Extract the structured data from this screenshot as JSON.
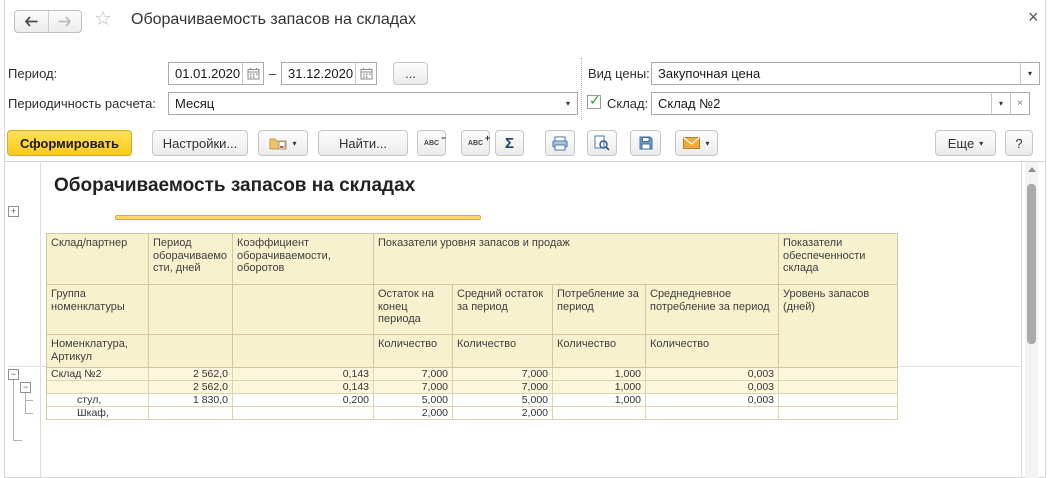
{
  "window": {
    "title": "Оборачиваемость запасов на складах"
  },
  "glyphs": {
    "dropdown": "▾",
    "close": "×",
    "star": "☆",
    "dash": "–",
    "ellipsis": "...",
    "plus": "+",
    "minus": "−",
    "sigma": "Σ",
    "abc": "ABC",
    "sup_minus": "−",
    "sup_plus": "+",
    "clear": "×",
    "check": "✓"
  },
  "filters": {
    "period_label": "Период:",
    "period_from": "01.01.2020",
    "period_to": "31.12.2020",
    "periodicity_label": "Периодичность расчета:",
    "periodicity_value": "Месяц",
    "price_type_label": "Вид цены:",
    "price_type_value": "Закупочная цена",
    "warehouse_label": "Склад:",
    "warehouse_value": "Склад №2"
  },
  "toolbar": {
    "generate": "Сформировать",
    "settings": "Настройки...",
    "find": "Найти...",
    "more": "Еще",
    "help": "?"
  },
  "report": {
    "title": "Оборачиваемость запасов на складах",
    "header": {
      "r1": [
        "Склад/партнер",
        "Период оборачиваемости, дней",
        "Коэффициент оборачиваемости, оборотов",
        "Показатели уровня запасов и продаж",
        "Показатели обеспеченности склада"
      ],
      "r2": [
        "Группа номенклатуры",
        "Остаток на конец периода",
        "Средний остаток за период",
        "Потребление за период",
        "Среднедневное потребление за период",
        "Уровень запасов (дней)"
      ],
      "r3": [
        "Номенклатура, Артикул",
        "Количество",
        "Количество",
        "Количество",
        "Количество"
      ]
    },
    "rows": [
      [
        "Склад №2",
        "2 562,0",
        "0,143",
        "7,000",
        "7,000",
        "1,000",
        "0,003",
        ""
      ],
      [
        "",
        "2 562,0",
        "0,143",
        "7,000",
        "7,000",
        "1,000",
        "0,003",
        ""
      ],
      [
        "стул,",
        "1 830,0",
        "0,200",
        "5,000",
        "5,000",
        "1,000",
        "0,003",
        ""
      ],
      [
        "Шкаф,",
        "",
        "",
        "2,000",
        "2,000",
        "",
        "",
        ""
      ]
    ]
  },
  "colors": {
    "accent_yellow": "#fcca1e",
    "header_cell": "#f7f1cd",
    "group_row": "#fbf6dc",
    "title_underline": "#f2c40f"
  }
}
